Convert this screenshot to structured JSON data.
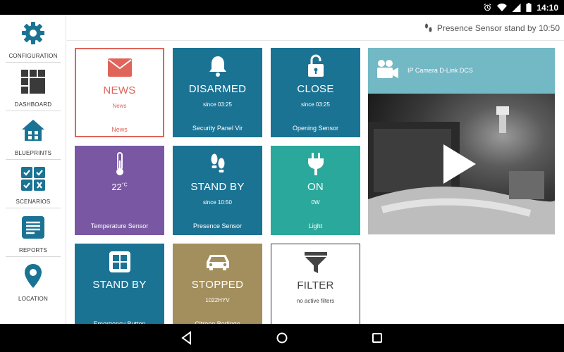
{
  "status_bar": {
    "time": "14:10",
    "icons": [
      "alarm-icon",
      "wifi-icon",
      "signal-icon",
      "battery-icon"
    ]
  },
  "sidebar": {
    "items": [
      {
        "label": "CONFIGURATION",
        "icon": "gear-icon"
      },
      {
        "label": "DASHBOARD",
        "icon": "dashboard-icon"
      },
      {
        "label": "BLUEPRINTS",
        "icon": "house-icon"
      },
      {
        "label": "SCENARIOS",
        "icon": "scenarios-icon"
      },
      {
        "label": "REPORTS",
        "icon": "reports-icon"
      },
      {
        "label": "LOCATION",
        "icon": "location-pin-icon"
      }
    ],
    "accent_color": "#1b7394"
  },
  "notification": {
    "text": "Presence Sensor stand by 10:50",
    "icon": "footprints-icon"
  },
  "tiles": [
    {
      "state": "NEWS",
      "since": "News",
      "name": "News",
      "icon": "envelope-icon",
      "color": "#e0645a"
    },
    {
      "state": "DISARMED",
      "since": "since 03:25",
      "name": "Security Panel Vir",
      "icon": "bell-icon",
      "color": "#1b7394"
    },
    {
      "state": "CLOSE",
      "since": "since 03:25",
      "name": "Opening Sensor",
      "icon": "unlocked-padlock-icon",
      "color": "#1b7394"
    },
    {
      "state": "22",
      "unit": "°C",
      "name": "Temperature Sensor",
      "icon": "thermometer-icon",
      "color": "#7a57a3"
    },
    {
      "state": "STAND BY",
      "since": "since 10:50",
      "name": "Presence Sensor",
      "icon": "footprints-icon",
      "color": "#1b7394"
    },
    {
      "state": "ON",
      "since": "0W",
      "name": "Light",
      "icon": "plug-icon",
      "color": "#2aa89c"
    },
    {
      "state": "STAND BY",
      "since": "",
      "name": "Emergency Button",
      "icon": "window-grid-icon",
      "color": "#1b7394"
    },
    {
      "state": "STOPPED",
      "since": "1022HYV",
      "name": "Citroen Berlingo",
      "icon": "car-icon",
      "color": "#a38e5d"
    },
    {
      "state": "FILTER",
      "since": "no active filters",
      "name": "",
      "icon": "funnel-icon",
      "color": "#444444"
    }
  ],
  "camera": {
    "title": "IP Camera D-Link DCS",
    "icon": "video-camera-icon",
    "play_icon": "play-icon"
  },
  "nav_bar": {
    "icons": [
      "back-icon",
      "home-icon",
      "recents-icon"
    ]
  }
}
